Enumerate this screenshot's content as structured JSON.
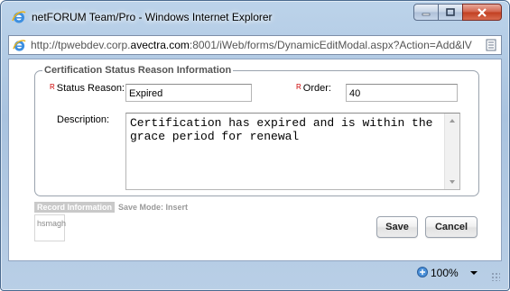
{
  "window": {
    "title": "netFORUM Team/Pro - Windows Internet Explorer",
    "address": {
      "prefix": "http://tpwebdev.corp.",
      "domain": "avectra.com",
      "suffix": ":8001/iWeb/forms/DynamicEditModal.aspx?Action=Add&lV"
    },
    "zoom": "100%"
  },
  "form": {
    "legend": "Certification Status Reason Information",
    "required_marker": "R",
    "status_reason": {
      "label": "Status Reason:",
      "value": "Expired"
    },
    "order": {
      "label": "Order:",
      "value": "40"
    },
    "description": {
      "label": "Description:",
      "value": "Certification has expired and is within the grace period for renewal"
    }
  },
  "record": {
    "tab_label": "Record Information",
    "save_mode": "Save Mode: Insert",
    "user": "hsmagh"
  },
  "buttons": {
    "save": "Save",
    "cancel": "Cancel"
  },
  "colors": {
    "required": "#cc0000",
    "close_button": "#c23f21"
  }
}
